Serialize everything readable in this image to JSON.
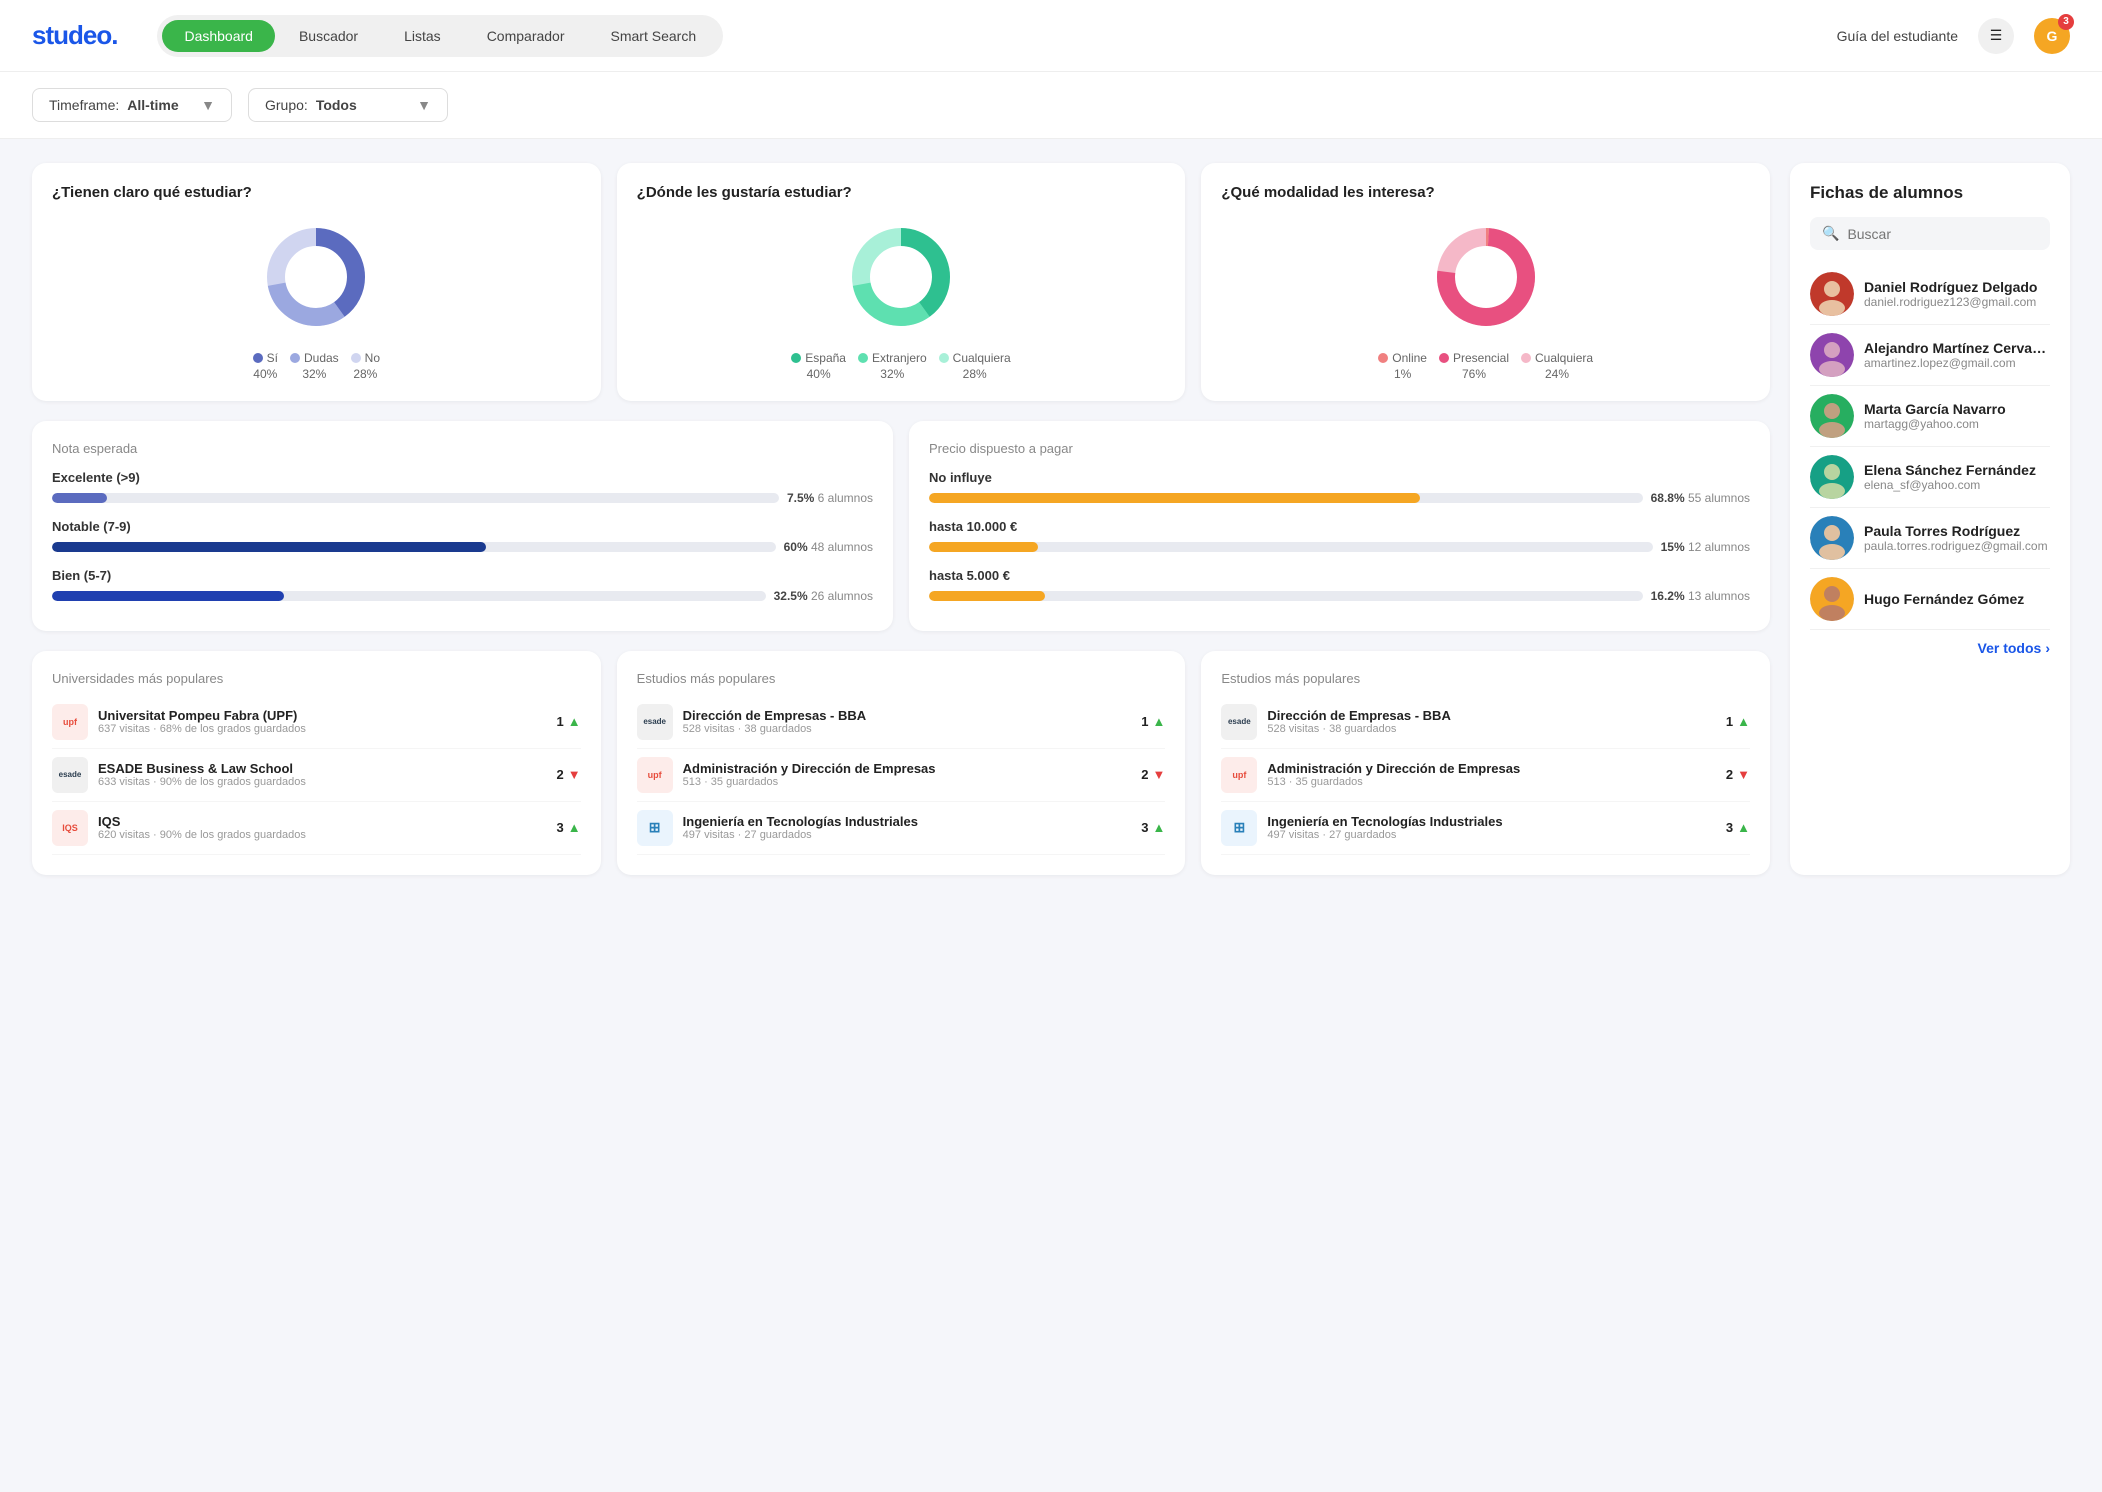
{
  "header": {
    "logo": "studeo.",
    "nav": [
      {
        "label": "Dashboard",
        "active": true
      },
      {
        "label": "Buscador",
        "active": false
      },
      {
        "label": "Listas",
        "active": false
      },
      {
        "label": "Comparador",
        "active": false
      },
      {
        "label": "Smart Search",
        "active": false
      }
    ],
    "guide_link": "Guía del estudiante",
    "menu_icon": "☰",
    "avatar_letter": "G",
    "notification_count": "3"
  },
  "filters": {
    "timeframe_label": "Timeframe:",
    "timeframe_value": "All-time",
    "grupo_label": "Grupo:",
    "grupo_value": "Todos"
  },
  "chart1": {
    "title": "¿Tienen claro qué estudiar?",
    "segments": [
      {
        "label": "Sí",
        "pct": 40,
        "color": "#5b6bbf"
      },
      {
        "label": "Dudas",
        "pct": 32,
        "color": "#9ba8e0"
      },
      {
        "label": "No",
        "pct": 28,
        "color": "#d0d5f0"
      }
    ]
  },
  "chart2": {
    "title": "¿Dónde les gustaría estudiar?",
    "segments": [
      {
        "label": "España",
        "pct": 40,
        "color": "#2ec090"
      },
      {
        "label": "Extranjero",
        "pct": 32,
        "color": "#5ee0b0"
      },
      {
        "label": "Cualquiera",
        "pct": 28,
        "color": "#a8f0d8"
      }
    ]
  },
  "chart3": {
    "title": "¿Qué modalidad les interesa?",
    "segments": [
      {
        "label": "Online",
        "pct": 1,
        "color": "#f08080"
      },
      {
        "label": "Presencial",
        "pct": 76,
        "color": "#e85080"
      },
      {
        "label": "Cualquiera",
        "pct": 24,
        "color": "#f5b8c8"
      }
    ]
  },
  "nota_esperada": {
    "section_label": "Nota esperada",
    "bars": [
      {
        "label": "Excelente (>9)",
        "pct": 7.5,
        "count": 6,
        "color": "#5b6bbf"
      },
      {
        "label": "Notable (7-9)",
        "pct": 60,
        "count": 48,
        "color": "#1a3a8f"
      },
      {
        "label": "Bien (5-7)",
        "pct": 32.5,
        "count": 26,
        "color": "#2040b0"
      }
    ]
  },
  "precio": {
    "section_label": "Precio dispuesto a pagar",
    "bars": [
      {
        "label": "No influye",
        "pct": 68.8,
        "count": 55,
        "color": "#f5a623"
      },
      {
        "label": "hasta 10.000 €",
        "pct": 15,
        "count": 12,
        "color": "#f5a623"
      },
      {
        "label": "hasta 5.000 €",
        "pct": 16.2,
        "count": 13,
        "color": "#f5a623"
      }
    ]
  },
  "fichas": {
    "title": "Fichas de alumnos",
    "search_placeholder": "Buscar",
    "students": [
      {
        "name": "Daniel Rodríguez Delgado",
        "email": "daniel.rodriguez123@gmail.com",
        "color": "#c0392b"
      },
      {
        "name": "Alejandro Martínez Cervan...",
        "email": "amartinez.lopez@gmail.com",
        "color": "#8e44ad"
      },
      {
        "name": "Marta García Navarro",
        "email": "martagg@yahoo.com",
        "color": "#27ae60"
      },
      {
        "name": "Elena Sánchez Fernández",
        "email": "elena_sf@yahoo.com",
        "color": "#16a085"
      },
      {
        "name": "Paula Torres Rodríguez",
        "email": "paula.torres.rodriguez@gmail.com",
        "color": "#2980b9"
      },
      {
        "name": "Hugo Fernández Gómez",
        "email": "",
        "color": "#f5a623"
      }
    ],
    "ver_todos": "Ver todos"
  },
  "universidades": {
    "section_label": "Universidades más populares",
    "items": [
      {
        "name": "Universitat Pompeu Fabra (UPF)",
        "sub": "637 visitas · 68% de los grados guardados",
        "rank": 1,
        "trend": "up",
        "logo_text": "upf",
        "logo_color": "#e74c3c",
        "logo_bg": "#fdecea"
      },
      {
        "name": "ESADE Business & Law School",
        "sub": "633 visitas · 90% de los grados guardados",
        "rank": 2,
        "trend": "down",
        "logo_text": "esade",
        "logo_color": "#2c3e50",
        "logo_bg": "#f0f0f0"
      },
      {
        "name": "IQS",
        "sub": "620 visitas · 90% de los grados guardados",
        "rank": 3,
        "trend": "up",
        "logo_text": "IQS",
        "logo_color": "#e74c3c",
        "logo_bg": "#fdecea"
      }
    ]
  },
  "estudios1": {
    "section_label": "Estudios más populares",
    "items": [
      {
        "name": "Dirección de Empresas - BBA",
        "sub": "528 visitas · 38 guardados",
        "rank": 1,
        "trend": "up",
        "logo_text": "esade",
        "logo_color": "#2c3e50",
        "logo_bg": "#f0f0f0"
      },
      {
        "name": "Administración y Dirección de Empresas",
        "sub": "513 · 35 guardados",
        "rank": 2,
        "trend": "down",
        "logo_text": "upf",
        "logo_color": "#e74c3c",
        "logo_bg": "#fdecea"
      },
      {
        "name": "Ingeniería en Tecnologías Industriales",
        "sub": "497 visitas · 27 guardados",
        "rank": 3,
        "trend": "up",
        "logo_text": "⊞",
        "logo_color": "#2980b9",
        "logo_bg": "#eaf4fd"
      }
    ]
  },
  "estudios2": {
    "section_label": "Estudios más populares",
    "items": [
      {
        "name": "Dirección de Empresas - BBA",
        "sub": "528 visitas · 38 guardados",
        "rank": 1,
        "trend": "up",
        "logo_text": "esade",
        "logo_color": "#2c3e50",
        "logo_bg": "#f0f0f0"
      },
      {
        "name": "Administración y Dirección de Empresas",
        "sub": "513 · 35 guardados",
        "rank": 2,
        "trend": "down",
        "logo_text": "upf",
        "logo_color": "#e74c3c",
        "logo_bg": "#fdecea"
      },
      {
        "name": "Ingeniería en Tecnologías Industriales",
        "sub": "497 visitas · 27 guardados",
        "rank": 3,
        "trend": "up",
        "logo_text": "⊞",
        "logo_color": "#2980b9",
        "logo_bg": "#eaf4fd"
      }
    ]
  }
}
